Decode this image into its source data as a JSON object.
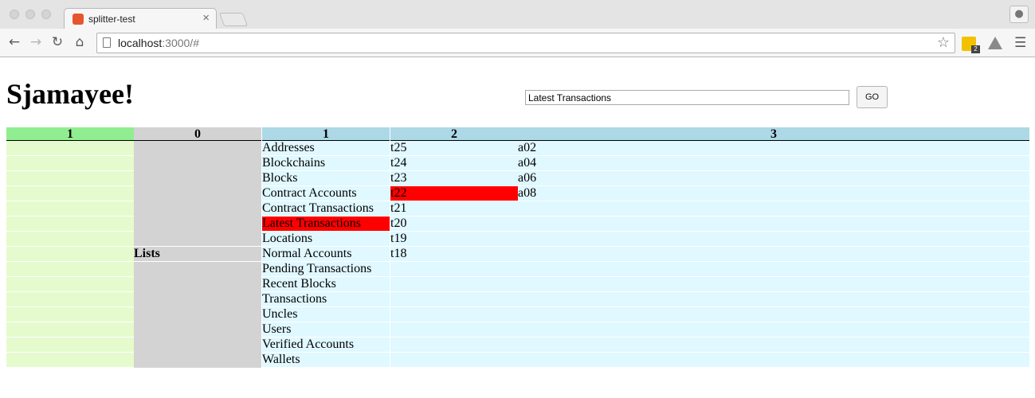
{
  "browser": {
    "tab_title": "splitter-test",
    "tab_close": "×",
    "url_host": "localhost",
    "url_rest": ":3000/#",
    "extension_badge": "2"
  },
  "page": {
    "title": "Sjamayee!",
    "search_value": "Latest Transactions",
    "go_label": "GO"
  },
  "columns": {
    "headers": [
      "1",
      "0",
      "1",
      "2",
      "3"
    ],
    "header_colors": [
      "#90ee90",
      "#d3d3d3",
      "#add8e6",
      "#add8e6",
      "#add8e6"
    ],
    "col0_label": "Lists",
    "lists": [
      "Addresses",
      "Blockchains",
      "Blocks",
      "Contract Accounts",
      "Contract Transactions",
      "Latest Transactions",
      "Locations",
      "Normal Accounts",
      "Pending Transactions",
      "Recent Blocks",
      "Transactions",
      "Uncles",
      "Users",
      "Verified Accounts",
      "Wallets"
    ],
    "selected_list": "Latest Transactions",
    "transactions": [
      "t25",
      "t24",
      "t23",
      "t22",
      "t21",
      "t20",
      "t19",
      "t18"
    ],
    "selected_transaction": "t22",
    "accounts": [
      "a02",
      "a04",
      "a06",
      "a08"
    ]
  },
  "colors": {
    "selected": "#ff0000",
    "column1_body": "#e5fbcd",
    "column0_body": "#d3d3d3",
    "lightblue_body": "#e0f8ff"
  }
}
